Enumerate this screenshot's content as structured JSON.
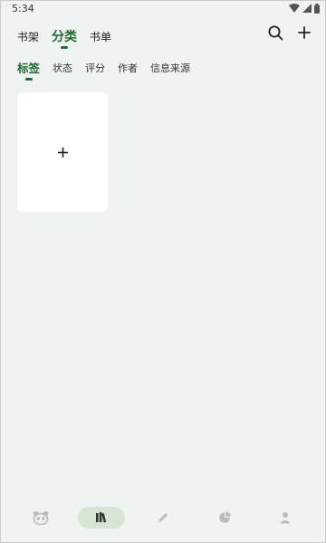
{
  "status_bar": {
    "time": "5:34",
    "icons": [
      "wifi-icon",
      "signal-icon",
      "battery-icon"
    ]
  },
  "top_tabs": [
    {
      "label": "书架",
      "active": false
    },
    {
      "label": "分类",
      "active": true
    },
    {
      "label": "书单",
      "active": false
    }
  ],
  "top_actions": [
    "search-icon",
    "plus-icon"
  ],
  "sub_tabs": [
    {
      "label": "标签",
      "active": true
    },
    {
      "label": "状态",
      "active": false
    },
    {
      "label": "评分",
      "active": false
    },
    {
      "label": "作者",
      "active": false
    },
    {
      "label": "信息来源",
      "active": false
    }
  ],
  "add_card": {
    "icon": "plus-icon"
  },
  "bottom_nav": [
    {
      "icon": "panda-icon",
      "active": false
    },
    {
      "icon": "books-icon",
      "active": true
    },
    {
      "icon": "pencil-icon",
      "active": false
    },
    {
      "icon": "pie-chart-icon",
      "active": false
    },
    {
      "icon": "person-icon",
      "active": false
    }
  ],
  "colors": {
    "accent": "#1e6b2c",
    "background": "#f1f3f2",
    "card": "#ffffff",
    "nav_active_bg": "#d5e5d2",
    "inactive_icon": "#b9bcbb"
  }
}
